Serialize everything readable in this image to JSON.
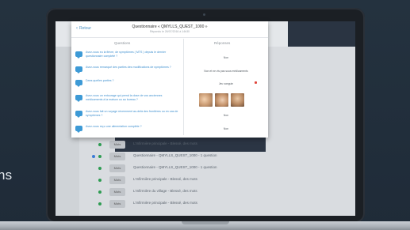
{
  "caption": {
    "text": "ns"
  },
  "modal": {
    "back_label": "Retour",
    "title": "Questionnaire « QMYLLS_QUEST_1000 »",
    "subtitle": "Répondu le 26/07/2016 à 14h30",
    "questions_header": "Questions",
    "answers_header": "Réponses",
    "questions": [
      "Avez-vous eu la fièvre, de symptômes ( MTS ) depuis le dernier questionnaire complété ?",
      "Avez-vous remarqué des parties des modifications de symptômes ?",
      "Dans quelles parties ?",
      "Avez-vous un entourage qui prend la dose de vos anciennes médicaments à la maison ou au bureau ?",
      "Avez-vous fait un voyage récemment au-delà des frontières ou en cas de symptômes ?",
      "Avez-vous reçu une alimentation complète ?"
    ],
    "answers": [
      "Non",
      "Non et ne vis pas sous médicaments",
      "Jeu sanguin",
      "Non",
      "Non"
    ]
  },
  "background_list": {
    "rows": [
      {
        "tag": "Mots",
        "text": "L'Infirmière principale - Blessé, des mots"
      },
      {
        "tag": "Mots",
        "text": "Questionnaire - QMYLLS_QUEST_1000 - 1 question"
      },
      {
        "tag": "Mots",
        "text": "Questionnaire - QMYLLS_QUEST_1000 - 1 question"
      },
      {
        "tag": "Mots",
        "text": "L'Infirmière principale - Blessé, des mots"
      },
      {
        "tag": "Mots",
        "text": "L'Infirmière du village - Blessé, des mots"
      },
      {
        "tag": "Mots",
        "text": "L'Infirmière principale - Blessé, des mots"
      }
    ]
  },
  "colors": {
    "background": "#22303f",
    "accent_blue": "#3d9ad6",
    "status_green": "#2e9c52",
    "alert_red": "#e0463c"
  }
}
